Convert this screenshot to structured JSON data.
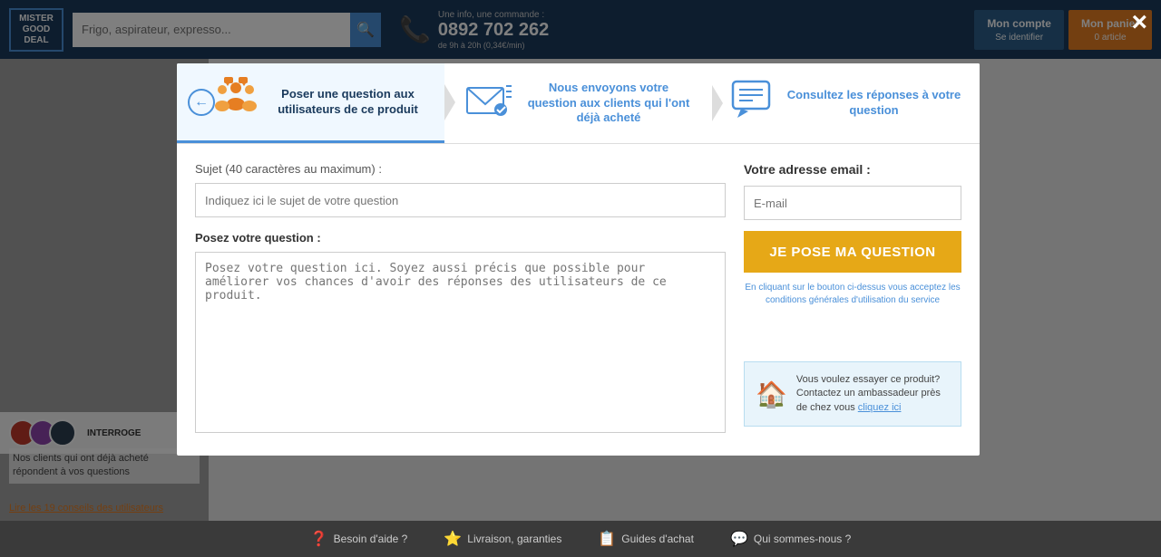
{
  "header": {
    "logo_line1": "MISTER",
    "logo_line2": "GOOD",
    "logo_line3": "DEAL",
    "search_placeholder": "Frigo, aspirateur, expresso...",
    "search_icon": "🔍",
    "phone_info": "Une info, une commande :",
    "phone_number": "0892 702 262",
    "phone_hours": "de 9h à 20h (0,34€/min)",
    "btn_account": "Mon compte",
    "btn_account_sub": "Se identifier",
    "btn_basket": "Mon panier",
    "btn_basket_sub": "0 article"
  },
  "footer": {
    "items": [
      {
        "icon": "❓",
        "label": "Besoin d'aide ?"
      },
      {
        "icon": "⭐",
        "label": "Livraison, garanties"
      },
      {
        "icon": "📋",
        "label": "Guides d'achat"
      },
      {
        "icon": "💬",
        "label": "Qui sommes-nous ?"
      }
    ]
  },
  "modal": {
    "close_label": "×",
    "steps": [
      {
        "label": "Poser une question aux utilisateurs de ce produit",
        "active": true
      },
      {
        "label": "Nous envoyons votre question aux clients qui l'ont déjà acheté",
        "active": false
      },
      {
        "label": "Consultez les réponses à votre question",
        "active": false
      }
    ],
    "form": {
      "subject_label": "Sujet",
      "subject_constraint": "(40 caractères au maximum) :",
      "subject_placeholder": "Indiquez ici le sujet de votre question",
      "question_label": "Posez votre question :",
      "question_placeholder": "Posez votre question ici. Soyez aussi précis que possible pour améliorer vos chances d'avoir des réponses des utilisateurs de ce produit."
    },
    "right_panel": {
      "email_label": "Votre adresse email :",
      "email_placeholder": "E-mail",
      "submit_label": "JE POSE MA QUESTION",
      "terms_text": "En cliquant sur le bouton ci-dessus vous acceptez les conditions générales d'utilisation du service",
      "ambassador_text": "Vous voulez essayer ce produit? Contactez un ambassadeur près de chez vous",
      "ambassador_link": "cliquez ici"
    }
  },
  "background": {
    "interroge_label": "INTERROGE",
    "clients_text": "Nos clients qui ont déjà acheté répondent à vos questions",
    "lire_link": "Lire les 19 conseils des utilisateurs"
  }
}
